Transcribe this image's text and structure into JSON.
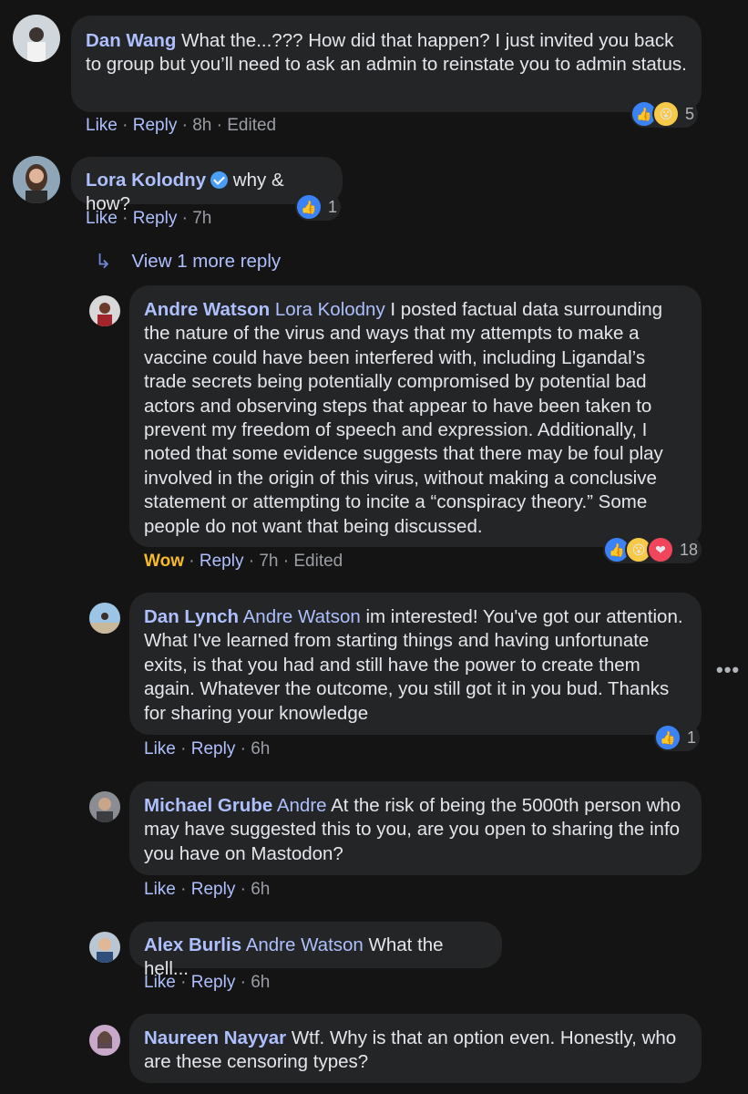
{
  "comments": [
    {
      "author": "Dan Wang",
      "text": " What the...??? How did that happen? I just invited you back to group but you’ll need to ask an admin to reinstate you to admin status.",
      "actions": {
        "like": "Like",
        "reply": "Reply",
        "time": "8h",
        "edited": "Edited"
      },
      "reaction_count": "5"
    },
    {
      "author": "Lora Kolodny",
      "text": " why & how?",
      "actions": {
        "like": "Like",
        "reply": "Reply",
        "time": "7h"
      },
      "reaction_count": "1"
    },
    {
      "author": "Andre Watson",
      "mention": "Lora Kolodny",
      "text": " I posted factual data surrounding the nature of the virus and ways that my attempts to make a vaccine could have been interfered with, including Ligandal’s trade secrets being potentially compromised by potential bad actors and observing steps that appear to have been taken to prevent my freedom of speech and expression. Additionally, I noted that some evidence suggests that there may be foul play involved in the origin of this virus, without making a conclusive statement or attempting to incite a “conspiracy theory.” Some people do not want that being discussed.",
      "actions": {
        "like": "Wow",
        "reply": "Reply",
        "time": "7h",
        "edited": "Edited"
      },
      "reaction_count": "18"
    },
    {
      "author": "Dan Lynch",
      "mention": "Andre Watson",
      "text": " im interested! You've got our attention. What I've learned from starting things and having unfortunate exits, is that you had and still have the power to create them again. Whatever the outcome, you still got it in you bud. Thanks for sharing your knowledge",
      "actions": {
        "like": "Like",
        "reply": "Reply",
        "time": "6h"
      },
      "reaction_count": "1"
    },
    {
      "author": "Michael Grube",
      "mention": "Andre",
      "text": " At the risk of being the 5000th person who may have suggested this to you, are you open to sharing the info you have on Mastodon?",
      "actions": {
        "like": "Like",
        "reply": "Reply",
        "time": "6h"
      }
    },
    {
      "author": "Alex Burlis",
      "mention": "Andre Watson",
      "text": " What the hell...",
      "actions": {
        "like": "Like",
        "reply": "Reply",
        "time": "6h"
      }
    },
    {
      "author": "Naureen Nayyar",
      "text": " Wtf. Why is that an option even. Honestly, who are these censoring types?"
    }
  ],
  "view_more": "View 1 more reply",
  "sep": " · ",
  "colors": {
    "background": "#141414",
    "bubble": "#242526",
    "name": "#aebffd",
    "wow": "#f7b928"
  }
}
